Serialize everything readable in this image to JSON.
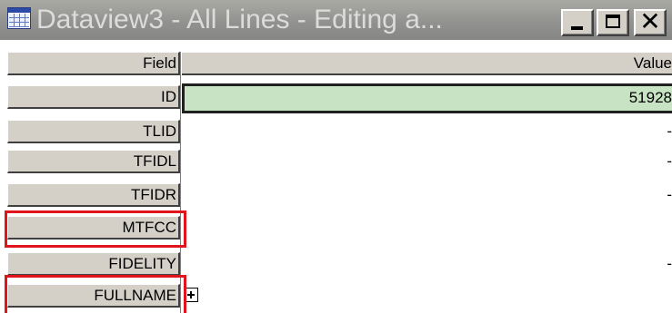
{
  "window": {
    "title": "Dataview3 - All Lines - Editing a...",
    "icon": "table-grid-icon",
    "buttons": {
      "minimize": "minimize-icon",
      "maximize": "maximize-icon",
      "close_glyph": "✕"
    }
  },
  "grid": {
    "header": {
      "field": "Field",
      "value": "Value"
    },
    "rows": [
      {
        "field": "ID",
        "value": "51928"
      },
      {
        "field": "TLID",
        "value": "-"
      },
      {
        "field": "TFIDL",
        "value": "-"
      },
      {
        "field": "TFIDR",
        "value": "-"
      },
      {
        "field": "MTFCC",
        "value": ""
      },
      {
        "field": "FIDELITY",
        "value": "-"
      },
      {
        "field": "FULLNAME",
        "value": ""
      }
    ],
    "selected_row": "ID",
    "highlighted_fields": [
      "MTFCC",
      "FULLNAME"
    ]
  },
  "colors": {
    "selection_fill": "#c8e2c4",
    "highlight_border": "#e0141a",
    "header_fill": "#d4d0c8"
  }
}
